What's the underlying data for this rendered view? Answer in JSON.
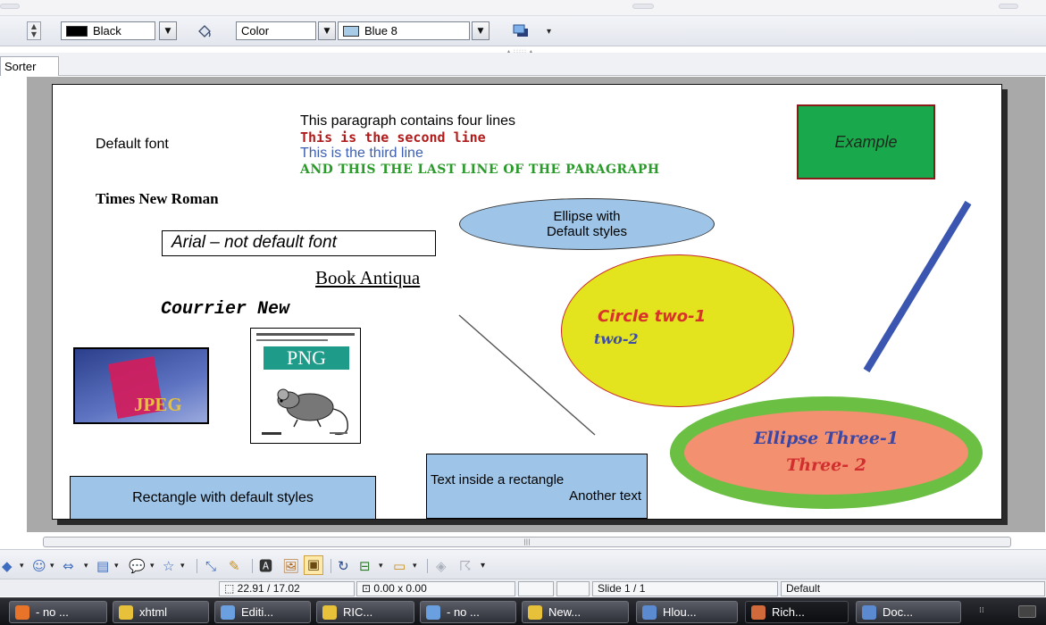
{
  "toolbar": {
    "line_color_label": "Black",
    "line_color_hex": "#000000",
    "area_style_label": "Color",
    "area_fill_label": "Blue 8",
    "area_fill_hex": "#a8cce8"
  },
  "tabs": {
    "sorter_label": "Sorter"
  },
  "slide": {
    "default_font_label": "Default font",
    "paragraph_lines": [
      "This paragraph contains four lines",
      "This is the second line",
      "This is the third line",
      "AND THIS THE LAST LINE OF THE PARAGRAPH"
    ],
    "times_label": "Times New Roman",
    "arial_label": "Arial – not default font",
    "book_antiqua_label": "Book Antiqua",
    "courier_label": "Courrier New",
    "ellipse_line1": "Ellipse with",
    "ellipse_line2": "Default styles",
    "example_label": "Example",
    "circle_line1": "Circle two-1",
    "circle_line2": "two-2",
    "ellipse3_line1": "Ellipse Three-1",
    "ellipse3_line2": "Three- 2",
    "jpeg_label": "JPEG",
    "png_label": "PNG",
    "rect1_label": "Rectangle with default styles",
    "rect2_line1": "Text inside a rectangle",
    "rect2_line2": "Another text",
    "colors": {
      "paragraph_line2": "#b11a1a",
      "paragraph_line3": "#3d5fb0",
      "paragraph_line4": "#2a9a2a",
      "example_fill": "#1aa84c",
      "circle_fill": "#e3e31e",
      "ellipse3_fill": "#f29070",
      "ellipse3_border": "#6bbf43",
      "diagonal_bar": "#3b56b0"
    }
  },
  "status": {
    "position": "22.91 / 17.02",
    "size": "0.00 x 0.00",
    "slide": "Slide 1 / 1",
    "layout": "Default"
  },
  "taskbar": [
    {
      "label": "- no ...",
      "icon": "firefox-icon",
      "color": "#e8742a"
    },
    {
      "label": "xhtml",
      "icon": "folder-icon",
      "color": "#e8c13a"
    },
    {
      "label": "Editi...",
      "icon": "globe-icon",
      "color": "#6aa0e0"
    },
    {
      "label": "RIC...",
      "icon": "folder-icon",
      "color": "#e8c13a"
    },
    {
      "label": "- no ...",
      "icon": "globe-icon",
      "color": "#6aa0e0"
    },
    {
      "label": "New...",
      "icon": "folder-icon",
      "color": "#e8c13a"
    },
    {
      "label": "Hlou...",
      "icon": "writer-doc-icon",
      "color": "#5b8ad0"
    },
    {
      "label": "Rich...",
      "icon": "impress-icon",
      "color": "#d06a3a"
    },
    {
      "label": "Doc...",
      "icon": "writer-doc-icon",
      "color": "#5b8ad0"
    }
  ]
}
